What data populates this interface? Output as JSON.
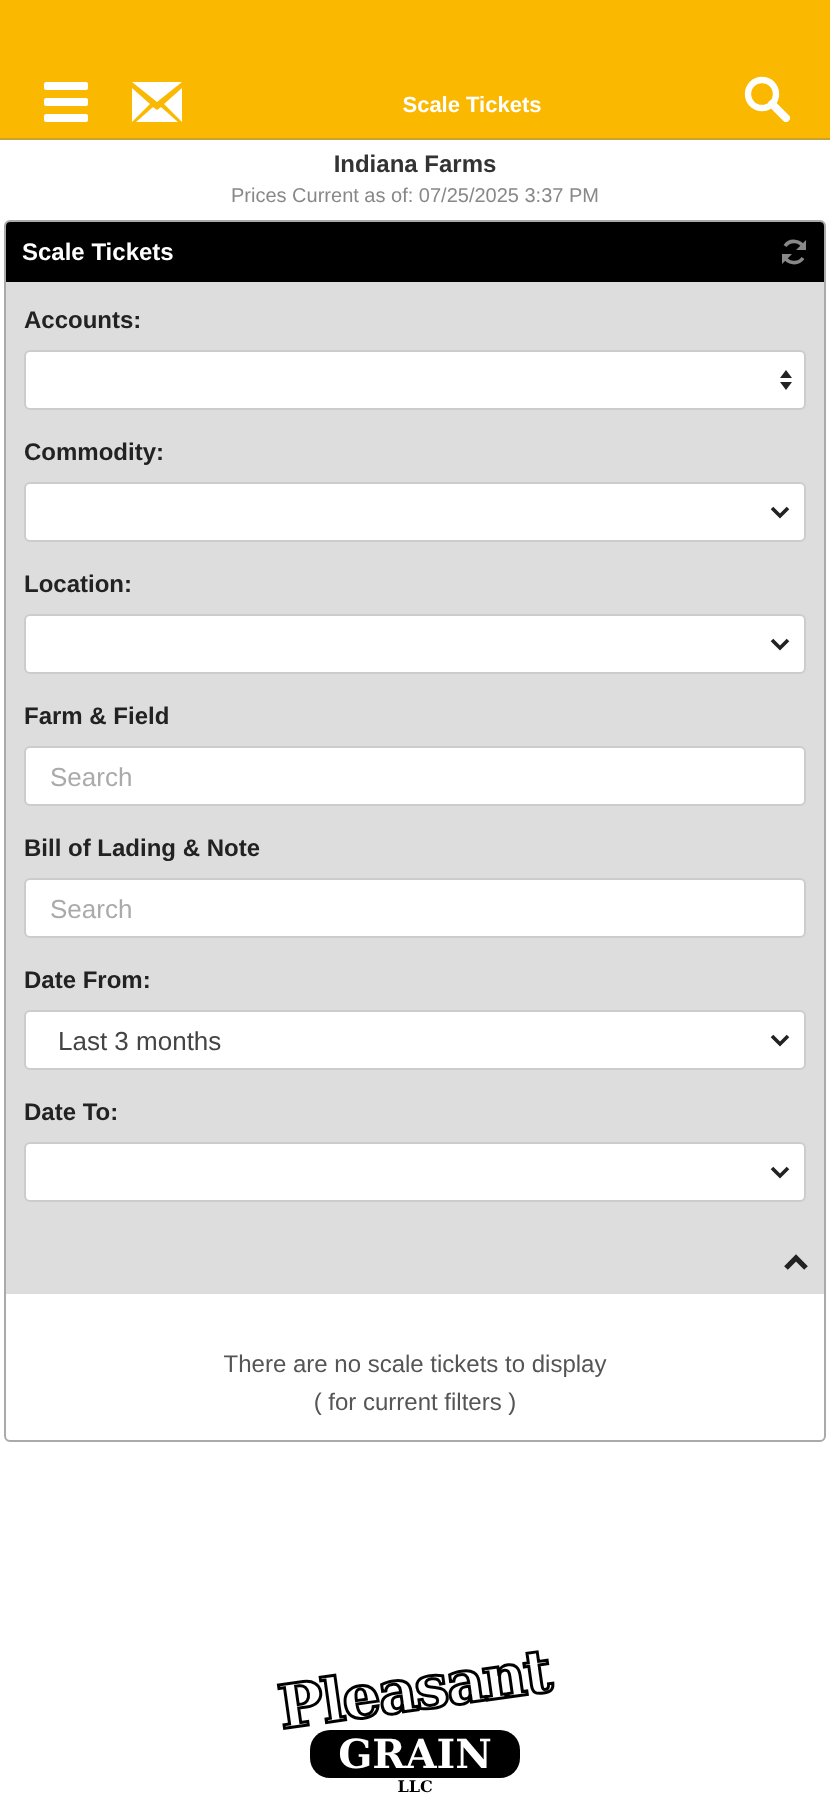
{
  "header": {
    "title": "Scale Tickets"
  },
  "account": {
    "name": "Indiana Farms",
    "prices_note": "Prices Current as of: 07/25/2025 3:37 PM"
  },
  "panel": {
    "title": "Scale Tickets",
    "filters": [
      {
        "label": "Accounts:",
        "kind": "stepper"
      },
      {
        "label": "Commodity:",
        "kind": "select"
      },
      {
        "label": "Location:",
        "kind": "select"
      },
      {
        "label": "Farm & Field",
        "kind": "search",
        "placeholder": "Search"
      },
      {
        "label": "Bill of Lading & Note",
        "kind": "search",
        "placeholder": "Search"
      },
      {
        "label": "Date From:",
        "kind": "select",
        "value": "Last 3 months"
      },
      {
        "label": "Date To:",
        "kind": "select"
      }
    ],
    "filters_expanded": true,
    "empty_message": [
      "There are no scale tickets to display",
      "( for current filters )"
    ]
  },
  "logo": {
    "script": "Pleasant",
    "banner": "GRAIN",
    "suffix": "LLC"
  }
}
